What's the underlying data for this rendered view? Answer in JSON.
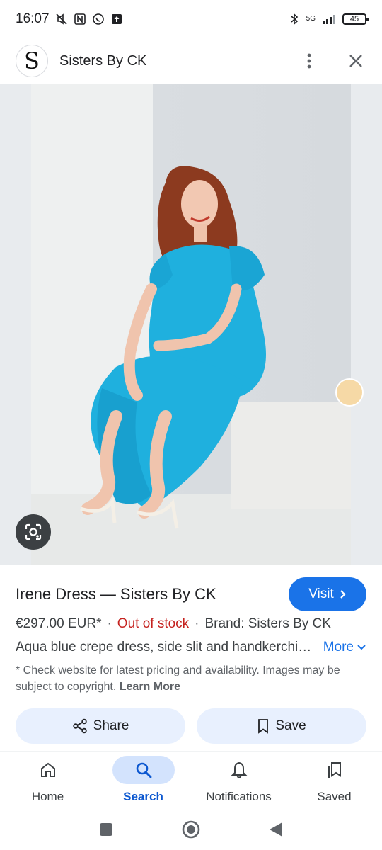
{
  "status_bar": {
    "time": "16:07",
    "network": "5G",
    "battery": "45",
    "icons": [
      "mute-vibrate-icon",
      "nfc-icon",
      "whatsapp-icon",
      "upload-icon",
      "bluetooth-icon",
      "signal-icon"
    ]
  },
  "header": {
    "avatar_letter": "S",
    "site_name": "Sisters By CK",
    "icons": [
      "more-vert-icon",
      "close-icon"
    ]
  },
  "product": {
    "title": "Irene Dress — Sisters By CK",
    "visit_label": "Visit",
    "price": "€297.00 EUR*",
    "stock": "Out of stock",
    "brand": "Brand: Sisters By CK",
    "description": "Aqua blue crepe dress, side slit and handkerchief sleeves",
    "more_label": "More",
    "disclaimer": "* Check website for latest pricing and availability. Images may be subject to copyright.",
    "learn_more": "Learn More"
  },
  "actions": {
    "share_label": "Share",
    "save_label": "Save"
  },
  "bottom_nav": {
    "items": [
      {
        "label": "Home",
        "icon": "home-icon",
        "active": false
      },
      {
        "label": "Search",
        "icon": "search-icon",
        "active": true
      },
      {
        "label": "Notifications",
        "icon": "bell-icon",
        "active": false
      },
      {
        "label": "Saved",
        "icon": "bookmarks-icon",
        "active": false
      }
    ]
  },
  "colors": {
    "accent": "#1a73e8",
    "stock_red": "#c5221f",
    "pill_bg": "#e8f0fe",
    "dress": "#1fb0de"
  }
}
